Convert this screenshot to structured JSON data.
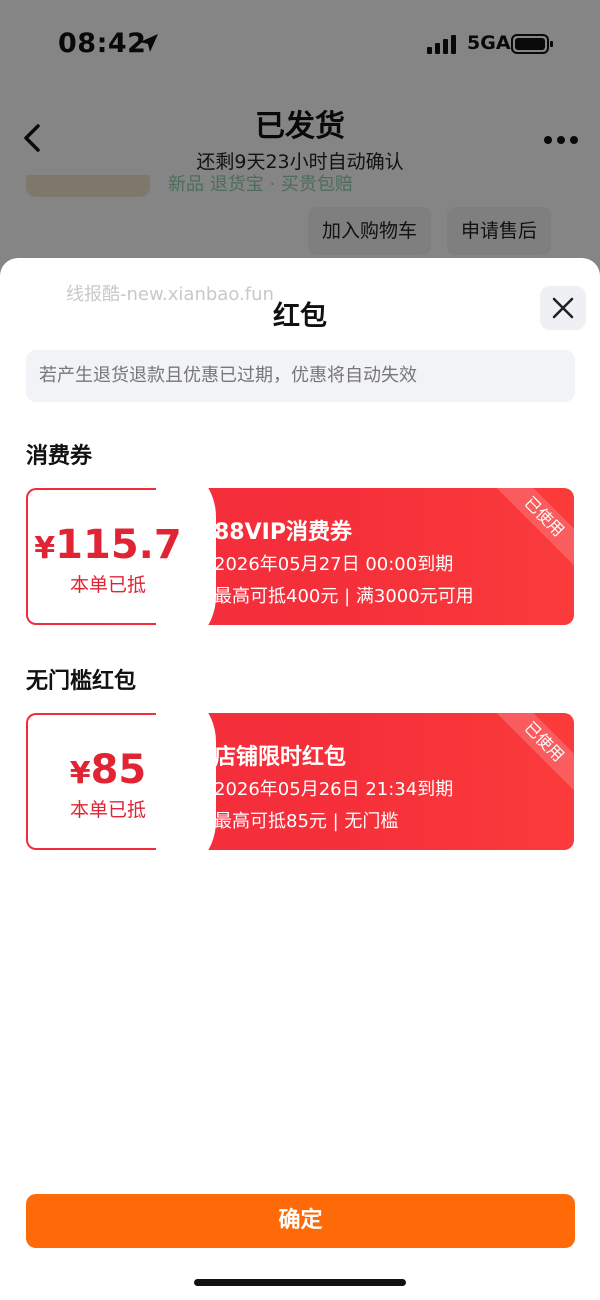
{
  "status_bar": {
    "time": "08:42",
    "network": "5GA"
  },
  "nav": {
    "title": "已发货",
    "subtitle": "还剩9天23小时自动确认"
  },
  "background": {
    "peek_text": "新品 退货宝 · 买贵包赔",
    "add_to_cart": "加入购物车",
    "after_sales": "申请售后"
  },
  "sheet": {
    "watermark": "线报酷-new.xianbao.fun",
    "title": "红包",
    "notice": "若产生退货退款且优惠已过期，优惠将自动失效",
    "sections": [
      {
        "title": "消费券",
        "coupon": {
          "currency": "¥",
          "amount": "115.7",
          "amount_label": "本单已抵",
          "name": "88VIP消费券",
          "expiry": "2026年05月27日 00:00到期",
          "rule": "最高可抵400元 | 满3000元可用",
          "status": "已使用"
        }
      },
      {
        "title": "无门槛红包",
        "coupon": {
          "currency": "¥",
          "amount": "85",
          "amount_label": "本单已抵",
          "name": "店铺限时红包",
          "expiry": "2026年05月26日 21:34到期",
          "rule": "最高可抵85元 | 无门槛",
          "status": "已使用"
        }
      }
    ],
    "confirm_label": "确定"
  },
  "colors": {
    "accent_red": "#f32a3c",
    "confirm_orange": "#fe6a07"
  },
  "icons": [
    "location-arrow-icon",
    "signal-icon",
    "battery-icon",
    "back-chevron-icon",
    "more-icon",
    "close-icon"
  ]
}
